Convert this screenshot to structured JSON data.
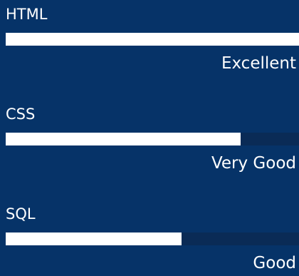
{
  "skills": [
    {
      "name": "HTML",
      "rating": "Excellent",
      "level": 1.0
    },
    {
      "name": "CSS",
      "rating": "Very Good",
      "level": 0.8
    },
    {
      "name": "SQL",
      "rating": "Good",
      "level": 0.6
    }
  ]
}
